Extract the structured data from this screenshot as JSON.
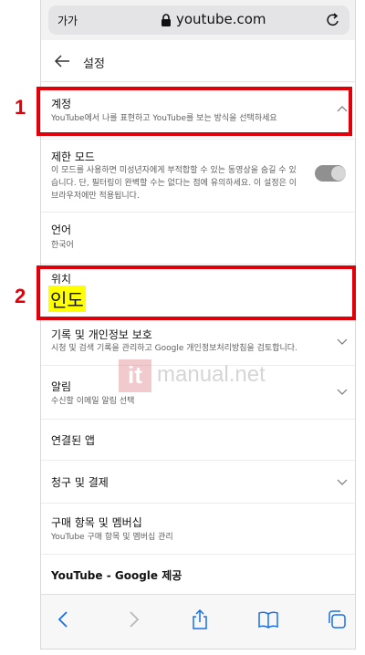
{
  "browser": {
    "text_size_label": "가가",
    "url": "youtube.com"
  },
  "header": {
    "title": "설정"
  },
  "settings": {
    "account": {
      "title": "계정",
      "subtitle": "YouTube에서 나를 표현하고 YouTube를 보는 방식을 선택하세요"
    },
    "restricted": {
      "title": "제한 모드",
      "subtitle_lines": [
        "이 모드를 사용하면 미성년자에게 부적합할 수 있는 동영상을 숨길 수 있",
        "습니다. 단, 필터링이 완벽할 수는 없다는 점에 유의하세요. 이 설정은 이",
        "브라우저에만 적용됩니다."
      ],
      "toggle_on": false
    },
    "language": {
      "title": "언어",
      "value": "한국어"
    },
    "location": {
      "title": "위치",
      "value": "인도"
    },
    "history": {
      "title": "기록 및 개인정보 보호",
      "subtitle": "시청 및 검색 기록을 관리하고 Google 개인정보처리방침을 검토합니다."
    },
    "notifications": {
      "title": "알림",
      "subtitle": "수신할 이메일 알림 선택"
    },
    "connected_apps": {
      "title": "연결된 앱"
    },
    "billing": {
      "title": "청구 및 결제"
    },
    "purchases": {
      "title": "구매 항목 및 멤버십",
      "subtitle": "YouTube 구매 항목 및 멤버십 관리"
    },
    "youtube_google": {
      "title": "YouTube - Google 제공"
    }
  },
  "annotations": {
    "box1_label": "1",
    "box2_label": "2",
    "color": "#e0000a"
  },
  "watermark": {
    "logo_letter": "it",
    "text": "manual.net"
  },
  "icons": [
    "lock-icon",
    "reload-icon",
    "back-arrow-icon",
    "chevron-up-icon",
    "chevron-down-icon",
    "back-icon",
    "forward-icon",
    "share-icon",
    "bookmarks-icon",
    "tabs-icon"
  ]
}
